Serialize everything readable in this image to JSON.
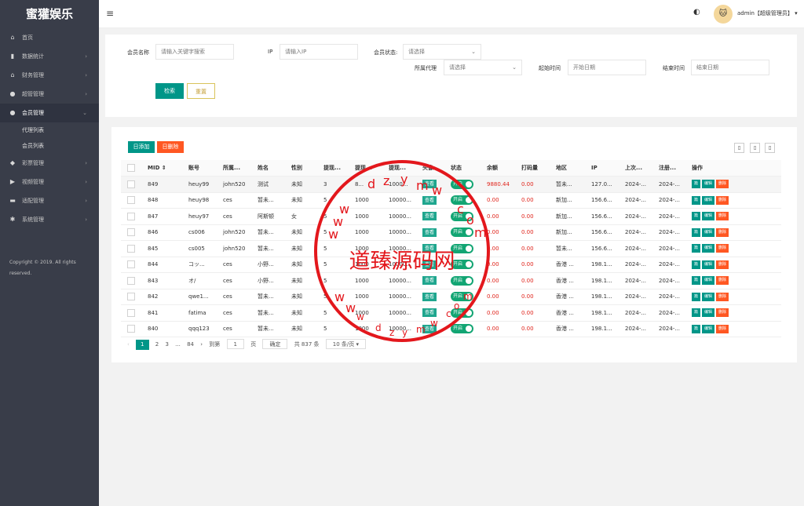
{
  "sidebar": {
    "logo": "蜜獾娱乐",
    "items": [
      {
        "label": "首页",
        "icon": "home-icon",
        "glyph": "⌂"
      },
      {
        "label": "数据统计",
        "icon": "chart-icon",
        "glyph": "▮",
        "arrow": "›"
      },
      {
        "label": "财务管理",
        "icon": "bank-icon",
        "glyph": "⌂",
        "arrow": "›"
      },
      {
        "label": "超管管理",
        "icon": "user-icon",
        "glyph": "●",
        "arrow": "›"
      },
      {
        "label": "会员管理",
        "icon": "users-icon",
        "glyph": "●",
        "arrow": "⌄"
      },
      {
        "label": "彩票管理",
        "icon": "gamepad-icon",
        "glyph": "◆",
        "arrow": "›"
      },
      {
        "label": "视频管理",
        "icon": "video-icon",
        "glyph": "▶",
        "arrow": "›"
      },
      {
        "label": "适配管理",
        "icon": "monitor-icon",
        "glyph": "▬",
        "arrow": "›"
      },
      {
        "label": "系统管理",
        "icon": "gear-icon",
        "glyph": "✱",
        "arrow": "›"
      }
    ],
    "subitems": [
      "代理列表",
      "会员列表"
    ],
    "copyright": "Copyright © 2019. All rights reserved."
  },
  "header": {
    "menu_icon": "≡",
    "theme_icon": "◐",
    "user": "admin【超级管理员】 ▾"
  },
  "filters": {
    "member_name_label": "会员名称",
    "member_name_ph": "请输入关键字搜索",
    "ip_label": "IP",
    "ip_ph": "请输入IP",
    "status_label": "会员状态:",
    "status_value": "请选择",
    "agent_label": "所属代理",
    "agent_value": "请选择",
    "start_label": "起始时间",
    "start_ph": "开始日期",
    "end_label": "结束时间",
    "end_ph": "结束日期",
    "search": "检索",
    "reset": "重置"
  },
  "toolbar": {
    "add": "日添加",
    "delete": "日删除"
  },
  "table": {
    "headers": [
      "MID",
      "账号",
      "所属...",
      "姓名",
      "性别",
      "提现...",
      "提现...",
      "提现...",
      "头像",
      "状态",
      "余额",
      "打码量",
      "地区",
      "IP",
      "上次...",
      "注册...",
      "操作"
    ],
    "rows": [
      [
        "849",
        "heuy99",
        "john520",
        "测试",
        "未知",
        "3",
        "8...",
        "1000...",
        "查看",
        "开启",
        "9880.44",
        "0.00",
        "暂未...",
        "127.0...",
        "2024-...",
        "2024-..."
      ],
      [
        "848",
        "heuy98",
        "ces",
        "暂未...",
        "未知",
        "5",
        "1000",
        "10000...",
        "查看",
        "开启",
        "0.00",
        "0.00",
        "新加...",
        "156.6...",
        "2024-...",
        "2024-..."
      ],
      [
        "847",
        "heuy97",
        "ces",
        "阿斯顿",
        "女",
        "5",
        "1000",
        "10000...",
        "查看",
        "开启",
        "0.00",
        "0.00",
        "新加...",
        "156.6...",
        "2024-...",
        "2024-..."
      ],
      [
        "846",
        "cs006",
        "john520",
        "暂未...",
        "未知",
        "5",
        "1000",
        "10000...",
        "查看",
        "开启",
        "0.00",
        "0.00",
        "新加...",
        "156.6...",
        "2024-...",
        "2024-..."
      ],
      [
        "845",
        "cs005",
        "john520",
        "暂未...",
        "未知",
        "5",
        "1000",
        "10000...",
        "查看",
        "开启",
        "0.00",
        "0.00",
        "暂未...",
        "156.6...",
        "2024-...",
        "2024-..."
      ],
      [
        "844",
        "コッ...",
        "ces",
        "小野...",
        "未知",
        "5",
        "1000",
        "10000...",
        "查看",
        "开启",
        "0.00",
        "0.00",
        "香港 ...",
        "198.1...",
        "2024-...",
        "2024-..."
      ],
      [
        "843",
        "オ/",
        "ces",
        "小野...",
        "未知",
        "5",
        "1000",
        "10000...",
        "查看",
        "开启",
        "0.00",
        "0.00",
        "香港 ...",
        "198.1...",
        "2024-...",
        "2024-..."
      ],
      [
        "842",
        "qwe1...",
        "ces",
        "暂未...",
        "未知",
        "5",
        "1000",
        "10000...",
        "查看",
        "开启",
        "0.00",
        "0.00",
        "香港 ...",
        "198.1...",
        "2024-...",
        "2024-..."
      ],
      [
        "841",
        "fatima",
        "ces",
        "暂未...",
        "未知",
        "5",
        "1000",
        "10000...",
        "查看",
        "开启",
        "0.00",
        "0.00",
        "香港 ...",
        "198.1...",
        "2024-...",
        "2024-..."
      ],
      [
        "840",
        "qqq123",
        "ces",
        "暂未...",
        "未知",
        "5",
        "1000",
        "10000...",
        "查看",
        "开启",
        "0.00",
        "0.00",
        "香港 ...",
        "198.1...",
        "2024-...",
        "2024-..."
      ]
    ],
    "ops": [
      "篇",
      "编辑",
      "删除"
    ]
  },
  "pagination": {
    "prev": "‹",
    "p1": "1",
    "p2": "2",
    "p3": "3",
    "dots": "...",
    "last": "84",
    "next": "›",
    "goto": "到第",
    "page": "1",
    "page_suffix": "页",
    "confirm": "确定",
    "total": "共 837 条",
    "per_page": "10 条/页 ▾"
  },
  "watermark": {
    "name": "道臻源码网",
    "url": [
      "d",
      "z",
      "y",
      "m",
      "w",
      ".",
      "c",
      "o",
      "m"
    ]
  }
}
